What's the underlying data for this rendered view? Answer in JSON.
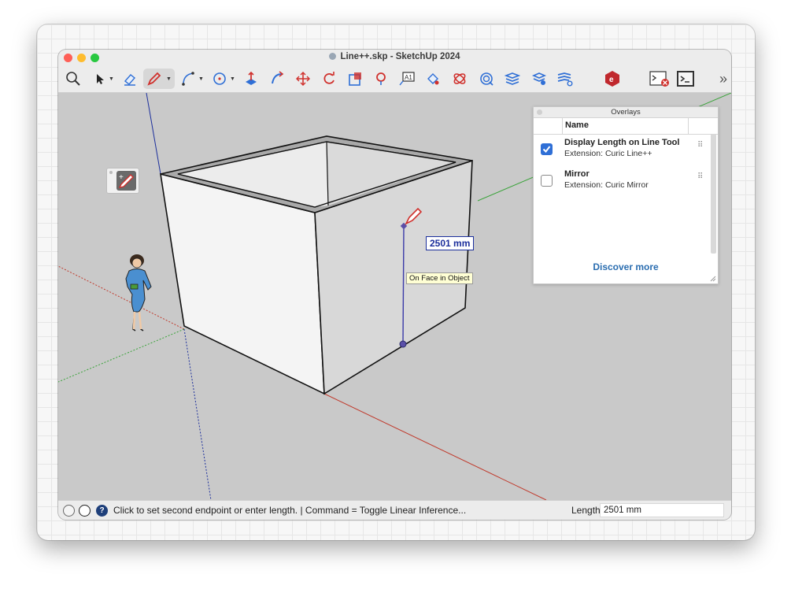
{
  "window": {
    "title": "Line++.skp - SketchUp 2024"
  },
  "toolbar": {
    "tools": [
      {
        "name": "zoom-icon"
      },
      {
        "name": "select-icon"
      },
      {
        "name": "eraser-icon"
      },
      {
        "name": "pencil-line-icon"
      },
      {
        "name": "arc-icon"
      },
      {
        "name": "circle-icon"
      },
      {
        "name": "push-pull-icon"
      },
      {
        "name": "follow-me-icon"
      },
      {
        "name": "move-icon"
      },
      {
        "name": "rotate-icon"
      },
      {
        "name": "scale-icon"
      },
      {
        "name": "tape-measure-icon"
      },
      {
        "name": "text-icon"
      },
      {
        "name": "paint-bucket-icon"
      },
      {
        "name": "orbit-icon"
      },
      {
        "name": "section-plane-icon"
      },
      {
        "name": "layers-icon"
      },
      {
        "name": "tags-icon"
      },
      {
        "name": "styles-icon"
      },
      {
        "name": "extension-warehouse-icon"
      },
      {
        "name": "ruby-console-error-icon"
      },
      {
        "name": "ruby-console-icon"
      }
    ],
    "more": "»"
  },
  "viewport": {
    "dimension_label": "2501 mm",
    "inference_tooltip": "On Face in Object"
  },
  "overlays_panel": {
    "title": "Overlays",
    "column_header": "Name",
    "items": [
      {
        "name": "Display Length on Line Tool",
        "extension": "Extension: Curic Line++",
        "checked": true
      },
      {
        "name": "Mirror",
        "extension": "Extension: Curic Mirror",
        "checked": false
      }
    ],
    "discover_link": "Discover more"
  },
  "statusbar": {
    "message": "Click to set second endpoint or enter length. | Command = Toggle Linear Inference...",
    "length_label": "Length",
    "length_value": "2501 mm"
  },
  "colors": {
    "accent": "#2f6fd6",
    "axis_red": "#c0392b",
    "axis_green": "#3aa33a",
    "axis_blue": "#1c2f9c"
  }
}
